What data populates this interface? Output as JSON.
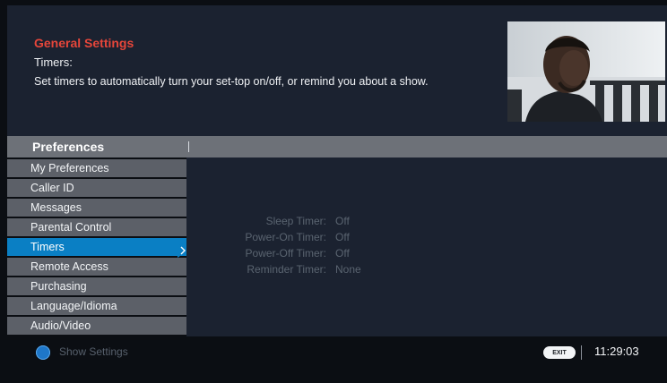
{
  "header": {
    "title": "General Settings",
    "subtitle": "Timers:",
    "description": "Set timers to automatically turn your set-top on/off, or remind you about a show."
  },
  "section": {
    "title": "Preferences"
  },
  "menu": {
    "items": [
      {
        "label": "My Preferences",
        "selected": false
      },
      {
        "label": "Caller ID",
        "selected": false
      },
      {
        "label": "Messages",
        "selected": false
      },
      {
        "label": "Parental Control",
        "selected": false
      },
      {
        "label": "Timers",
        "selected": true
      },
      {
        "label": "Remote Access",
        "selected": false
      },
      {
        "label": "Purchasing",
        "selected": false
      },
      {
        "label": "Language/Idioma",
        "selected": false
      },
      {
        "label": "Audio/Video",
        "selected": false
      }
    ]
  },
  "timers": [
    {
      "label": "Sleep Timer:",
      "value": "Off"
    },
    {
      "label": "Power-On Timer:",
      "value": "Off"
    },
    {
      "label": "Power-Off Timer:",
      "value": "Off"
    },
    {
      "label": "Reminder Timer:",
      "value": "None"
    }
  ],
  "footer": {
    "blue_button_icon": "blue-button-icon",
    "blue_button_label": "Show Settings",
    "exit_button_label": "EXIT",
    "clock": "11:29:03"
  },
  "colors": {
    "header_title": "#e6463a",
    "selected_item": "#0a7fc4",
    "menu_item": "#5c6068",
    "panel": "#1b2230"
  }
}
